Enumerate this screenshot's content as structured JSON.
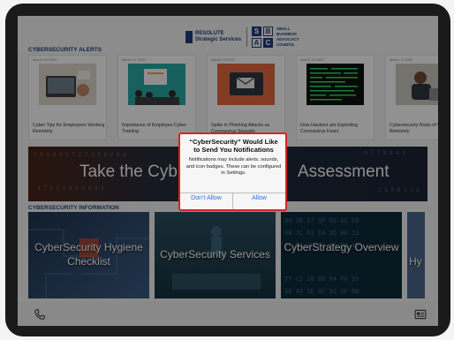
{
  "header": {
    "resolute_line1": "RESOLUTE",
    "resolute_line2": "Strategic Services",
    "sbac_letters": [
      "S",
      "B",
      "A",
      "C"
    ],
    "sbac_text": [
      "SMALL",
      "BUSINESS",
      "ADVOCACY",
      "COUNCIL"
    ]
  },
  "alerts_section": {
    "label": "CYBERSECURITY ALERTS",
    "cards": [
      {
        "date": "March 18 2020",
        "title": "Cyber Tips for Employees Working Remotely"
      },
      {
        "date": "March 17 2020",
        "title": "Importance of Employee Cyber Training"
      },
      {
        "date": "March 16 2020",
        "title": "Spike in Phishing Attacks as Coronavirus Spreads"
      },
      {
        "date": "March 13 2020",
        "title": "How Hackers are Exploiting Coronavirus Fears"
      },
      {
        "date": "March 11 2020",
        "title": "Cybersecurity Risks of Working Remotely"
      }
    ]
  },
  "banner": {
    "text_left": "Take the Cyb",
    "text_right": "Assessment"
  },
  "info_section": {
    "label": "CYBERSECURITY INFORMATION",
    "cards": [
      {
        "title": "CyberSecurity Hygiene Checklist"
      },
      {
        "title": "CyberSecurity Services"
      },
      {
        "title": "CyberStrategy Overview"
      },
      {
        "title": "Hy"
      }
    ]
  },
  "bottom_bar": {
    "left_icon": "phone-icon",
    "right_icon": "news-icon"
  },
  "dialog": {
    "title": "“CyberSecurity” Would Like to Send You Notifications",
    "message": "Notifications may include alerts, sounds, and icon badges. These can be configured in Settings.",
    "deny": "Don’t Allow",
    "allow": "Allow"
  },
  "colors": {
    "navy": "#1e3c7a",
    "alert_border": "#d52424",
    "ios_blue": "#1a73e8"
  }
}
